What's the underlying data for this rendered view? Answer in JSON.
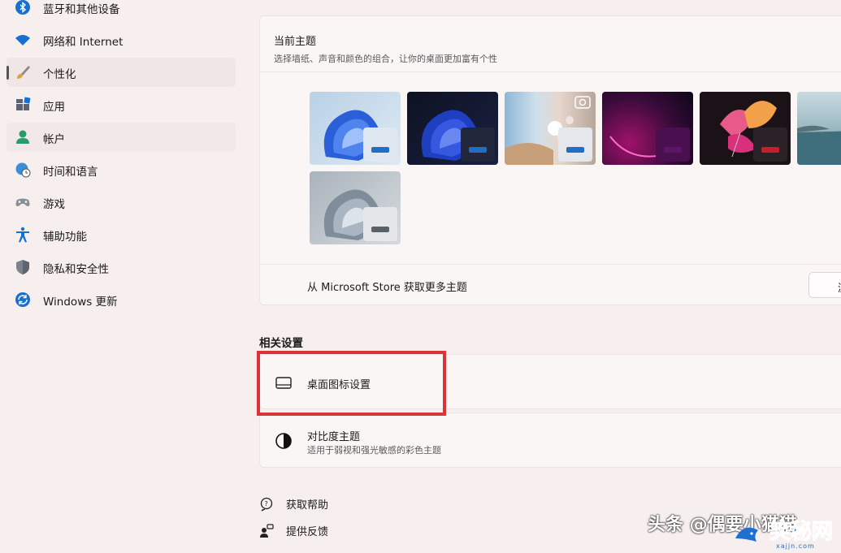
{
  "sidebar": {
    "items": [
      {
        "label": "蓝牙和其他设备",
        "icon": "bluetooth-icon"
      },
      {
        "label": "网络和 Internet",
        "icon": "wifi-icon"
      },
      {
        "label": "个性化",
        "icon": "brush-icon",
        "selected": true
      },
      {
        "label": "应用",
        "icon": "apps-icon"
      },
      {
        "label": "帐户",
        "icon": "account-icon"
      },
      {
        "label": "时间和语言",
        "icon": "globe-clock-icon"
      },
      {
        "label": "游戏",
        "icon": "gamepad-icon"
      },
      {
        "label": "辅助功能",
        "icon": "accessibility-icon"
      },
      {
        "label": "隐私和安全性",
        "icon": "shield-icon"
      },
      {
        "label": "Windows 更新",
        "icon": "update-icon"
      }
    ]
  },
  "themes": {
    "title": "当前主题",
    "subtitle": "选择墙纸、声音和颜色的组合，让你的桌面更加富有个性",
    "items": [
      {
        "name": "windows-light",
        "accent": "#1f6fc6"
      },
      {
        "name": "windows-dark",
        "accent": "#1f6fc6"
      },
      {
        "name": "glow-flowers",
        "accent": "#1f6fc6"
      },
      {
        "name": "captured-motion",
        "accent": "#5b1466"
      },
      {
        "name": "flow",
        "accent": "#c81e2c"
      },
      {
        "name": "sunrise-lake",
        "accent": "#1f6fc6"
      },
      {
        "name": "bloom-gray",
        "accent": "#5a6068"
      }
    ],
    "store_text": "从 Microsoft Store 获取更多主题",
    "store_button": "浏"
  },
  "related": {
    "title": "相关设置",
    "desktop_icons": {
      "title": "桌面图标设置",
      "icon": "monitor-icon"
    },
    "contrast": {
      "title": "对比度主题",
      "subtitle": "适用于弱视和强光敏感的彩色主题",
      "icon": "contrast-icon"
    }
  },
  "links": {
    "help": "获取帮助",
    "feedback": "提供反馈"
  },
  "watermark": {
    "text": "头条 @偶要小猫猫",
    "site": "xajjn.com",
    "logo": "笑秘网"
  },
  "colors": {
    "highlight": "#d8353b",
    "accent": "#1f6fc6",
    "background": "#f7eeee"
  }
}
